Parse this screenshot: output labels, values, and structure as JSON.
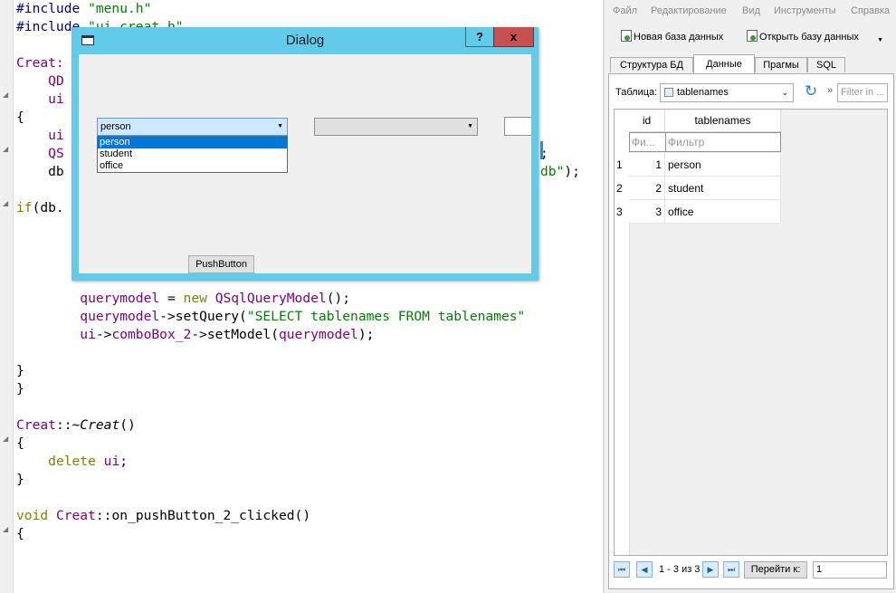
{
  "editor": {
    "lines": [
      {
        "tokens": [
          {
            "t": "#include ",
            "c": "pp"
          },
          {
            "t": "\"menu.h\"",
            "c": "str"
          }
        ]
      },
      {
        "tokens": [
          {
            "t": "#include ",
            "c": "pp"
          },
          {
            "t": "\"ui_creat.h\"",
            "c": "str"
          }
        ]
      },
      {
        "tokens": []
      },
      {
        "tokens": [
          {
            "t": "Creat:",
            "c": "cls"
          }
        ]
      },
      {
        "tokens": [
          {
            "t": "    "
          },
          {
            "t": "QD",
            "c": "cls"
          }
        ]
      },
      {
        "tokens": [
          {
            "t": "    "
          },
          {
            "t": "ui",
            "c": "cls"
          }
        ]
      },
      {
        "tokens": [
          {
            "t": "{"
          }
        ]
      },
      {
        "tokens": [
          {
            "t": "    "
          },
          {
            "t": "ui",
            "c": "cls"
          }
        ]
      },
      {
        "tokens": [
          {
            "t": "    "
          },
          {
            "t": "QS",
            "c": "cls"
          }
        ]
      },
      {
        "tokens": [
          {
            "t": "    db"
          }
        ]
      },
      {
        "tokens": []
      },
      {
        "tokens": [
          {
            "t": "if",
            "c": "kw"
          },
          {
            "t": "(db."
          }
        ]
      },
      {
        "tokens": []
      },
      {
        "tokens": []
      },
      {
        "tokens": []
      },
      {
        "tokens": []
      },
      {
        "tokens": [
          {
            "t": "        "
          },
          {
            "t": "querymodel",
            "c": "cls"
          },
          {
            "t": " = "
          },
          {
            "t": "new",
            "c": "kw"
          },
          {
            "t": " "
          },
          {
            "t": "QSqlQueryModel",
            "c": "cls"
          },
          {
            "t": "();"
          }
        ]
      },
      {
        "tokens": [
          {
            "t": "        "
          },
          {
            "t": "querymodel",
            "c": "cls"
          },
          {
            "t": "->setQuery("
          },
          {
            "t": "\"SELECT tablenames FROM tablenames\"",
            "c": "str"
          }
        ]
      },
      {
        "tokens": [
          {
            "t": "        "
          },
          {
            "t": "ui",
            "c": "cls"
          },
          {
            "t": "->"
          },
          {
            "t": "comboBox_2",
            "c": "cls"
          },
          {
            "t": "->setModel("
          },
          {
            "t": "querymodel",
            "c": "cls"
          },
          {
            "t": ");"
          }
        ]
      },
      {
        "tokens": []
      },
      {
        "tokens": [
          {
            "t": "}"
          }
        ]
      },
      {
        "tokens": [
          {
            "t": "}"
          }
        ]
      },
      {
        "tokens": []
      },
      {
        "tokens": [
          {
            "t": "Creat",
            "c": "cls"
          },
          {
            "t": "::~"
          },
          {
            "t": "Creat",
            "c": "it"
          },
          {
            "t": "()"
          }
        ]
      },
      {
        "tokens": [
          {
            "t": "{"
          }
        ]
      },
      {
        "tokens": [
          {
            "t": "    "
          },
          {
            "t": "delete",
            "c": "kw"
          },
          {
            "t": " "
          },
          {
            "t": "ui",
            "c": "cls"
          },
          {
            "t": ";"
          }
        ]
      },
      {
        "tokens": [
          {
            "t": "}"
          }
        ]
      },
      {
        "tokens": []
      },
      {
        "tokens": [
          {
            "t": "void",
            "c": "kw"
          },
          {
            "t": " "
          },
          {
            "t": "Creat",
            "c": "cls"
          },
          {
            "t": "::on_pushButton_2_clicked()"
          }
        ]
      },
      {
        "tokens": [
          {
            "t": "{"
          }
        ]
      }
    ],
    "fragments": {
      "line8_tail": ";",
      "line9_tail_str": "db\"",
      "line9_tail": ");"
    }
  },
  "dialog": {
    "title": "Dialog",
    "help_label": "?",
    "close_label": "x",
    "combo1_value": "person",
    "combo2_value": "",
    "dropdown_items": [
      "person",
      "student",
      "office"
    ],
    "dropdown_selected": 0,
    "push_button_label": "PushButton"
  },
  "dbbrowser": {
    "menu": [
      "Файл",
      "Редактирование",
      "Вид",
      "Инструменты",
      "Справка"
    ],
    "toolbar": {
      "new_db": "Новая база данных",
      "open_db": "Открыть базу данных"
    },
    "tabs": [
      "Структура БД",
      "Данные",
      "Прагмы",
      "SQL"
    ],
    "active_tab": 1,
    "table_label": "Таблица:",
    "table_selected": "tablenames",
    "filter_placeholder": "Filter in ...",
    "columns": [
      "id",
      "tablenames"
    ],
    "column_filters": [
      "Фи...",
      "Фильтр"
    ],
    "rows": [
      {
        "num": "1",
        "id": "1",
        "name": "person"
      },
      {
        "num": "2",
        "id": "2",
        "name": "student"
      },
      {
        "num": "3",
        "id": "3",
        "name": "office"
      }
    ],
    "nav": {
      "count": "1 - 3 из 3",
      "goto_label": "Перейти к:",
      "goto_value": "1"
    }
  },
  "colors": {
    "dialog_frame": "#63cbea",
    "close_button": "#c75050",
    "selection": "#0078d7",
    "keyword": "#808000",
    "class": "#800080",
    "string": "#008000"
  }
}
